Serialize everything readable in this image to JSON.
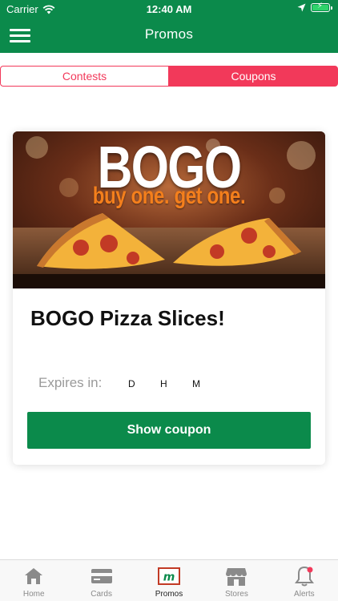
{
  "status_bar": {
    "carrier": "Carrier",
    "time": "12:40 AM"
  },
  "nav": {
    "title": "Promos"
  },
  "segments": {
    "contests": "Contests",
    "coupons": "Coupons",
    "selected": "Coupons"
  },
  "promo": {
    "image_headline": "BOGO",
    "image_tagline": "buy one. get one.",
    "title": "BOGO Pizza Slices!",
    "expires_label": "Expires in:",
    "days_unit": "D",
    "hours_unit": "H",
    "minutes_unit": "M",
    "button_label": "Show coupon"
  },
  "tabbar": {
    "items": [
      {
        "label": "Home",
        "icon": "home-icon"
      },
      {
        "label": "Cards",
        "icon": "card-icon"
      },
      {
        "label": "Promos",
        "icon": "promos-logo-icon"
      },
      {
        "label": "Stores",
        "icon": "store-icon"
      },
      {
        "label": "Alerts",
        "icon": "bell-icon"
      }
    ],
    "active": "Promos"
  },
  "colors": {
    "brand_green": "#0b8a4b",
    "accent_red": "#f2395a",
    "muted_gray": "#9a9a9a",
    "tagline_orange": "#f47f1c"
  }
}
